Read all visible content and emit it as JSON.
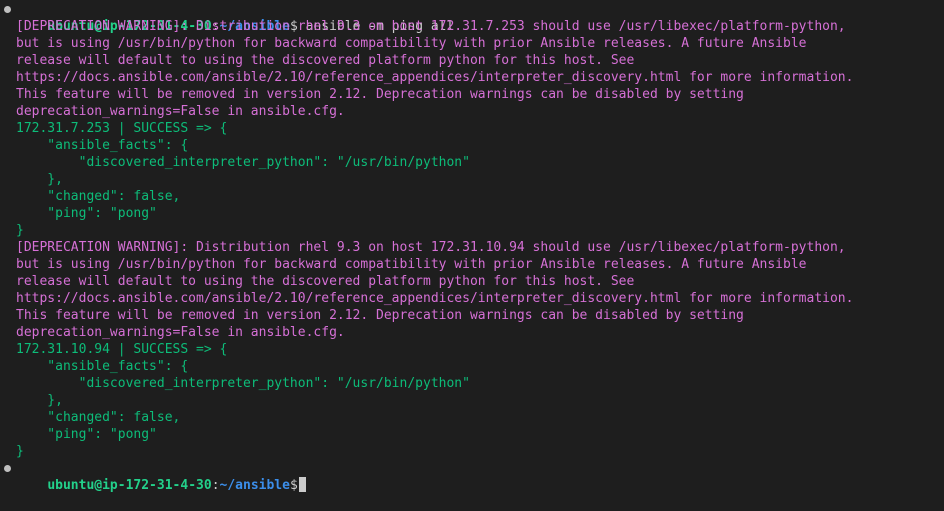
{
  "colors": {
    "background": "#1e1e1e",
    "prompt_user": "#23d18b",
    "prompt_path": "#3b8eea",
    "default_text": "#cccccc",
    "warning": "#d670d6",
    "success": "#0dbc79",
    "cursor": "#cccccc",
    "dot": "#bfbfbf"
  },
  "icons": {
    "command_marker": "circle-dot-icon"
  },
  "command": {
    "user_host": "ubuntu@ip-172-31-4-30",
    "separator": ":",
    "path": "~/ansible",
    "symbol": "$",
    "text": " ansible -m ping all"
  },
  "output": [
    {
      "style": "warning",
      "text": "[DEPRECATION WARNING]: Distribution rhel 9.3 on host 172.31.7.253 should use /usr/libexec/platform-python,"
    },
    {
      "style": "warning",
      "text": "but is using /usr/bin/python for backward compatibility with prior Ansible releases. A future Ansible"
    },
    {
      "style": "warning",
      "text": "release will default to using the discovered platform python for this host. See"
    },
    {
      "style": "warning",
      "text": "https://docs.ansible.com/ansible/2.10/reference_appendices/interpreter_discovery.html for more information."
    },
    {
      "style": "warning",
      "text": "This feature will be removed in version 2.12. Deprecation warnings can be disabled by setting"
    },
    {
      "style": "warning",
      "text": "deprecation_warnings=False in ansible.cfg."
    },
    {
      "style": "success",
      "text": "172.31.7.253 | SUCCESS => {"
    },
    {
      "style": "success",
      "text": "    \"ansible_facts\": {"
    },
    {
      "style": "success",
      "text": "        \"discovered_interpreter_python\": \"/usr/bin/python\""
    },
    {
      "style": "success",
      "text": "    },"
    },
    {
      "style": "success",
      "text": "    \"changed\": false,"
    },
    {
      "style": "success",
      "text": "    \"ping\": \"pong\""
    },
    {
      "style": "success",
      "text": "}"
    },
    {
      "style": "warning",
      "text": "[DEPRECATION WARNING]: Distribution rhel 9.3 on host 172.31.10.94 should use /usr/libexec/platform-python,"
    },
    {
      "style": "warning",
      "text": "but is using /usr/bin/python for backward compatibility with prior Ansible releases. A future Ansible"
    },
    {
      "style": "warning",
      "text": "release will default to using the discovered platform python for this host. See"
    },
    {
      "style": "warning",
      "text": "https://docs.ansible.com/ansible/2.10/reference_appendices/interpreter_discovery.html for more information."
    },
    {
      "style": "warning",
      "text": "This feature will be removed in version 2.12. Deprecation warnings can be disabled by setting"
    },
    {
      "style": "warning",
      "text": "deprecation_warnings=False in ansible.cfg."
    },
    {
      "style": "success",
      "text": "172.31.10.94 | SUCCESS => {"
    },
    {
      "style": "success",
      "text": "    \"ansible_facts\": {"
    },
    {
      "style": "success",
      "text": "        \"discovered_interpreter_python\": \"/usr/bin/python\""
    },
    {
      "style": "success",
      "text": "    },"
    },
    {
      "style": "success",
      "text": "    \"changed\": false,"
    },
    {
      "style": "success",
      "text": "    \"ping\": \"pong\""
    },
    {
      "style": "success",
      "text": "}"
    }
  ],
  "prompt": {
    "user_host": "ubuntu@ip-172-31-4-30",
    "separator": ":",
    "path": "~/ansible",
    "symbol": "$",
    "input_value": ""
  }
}
